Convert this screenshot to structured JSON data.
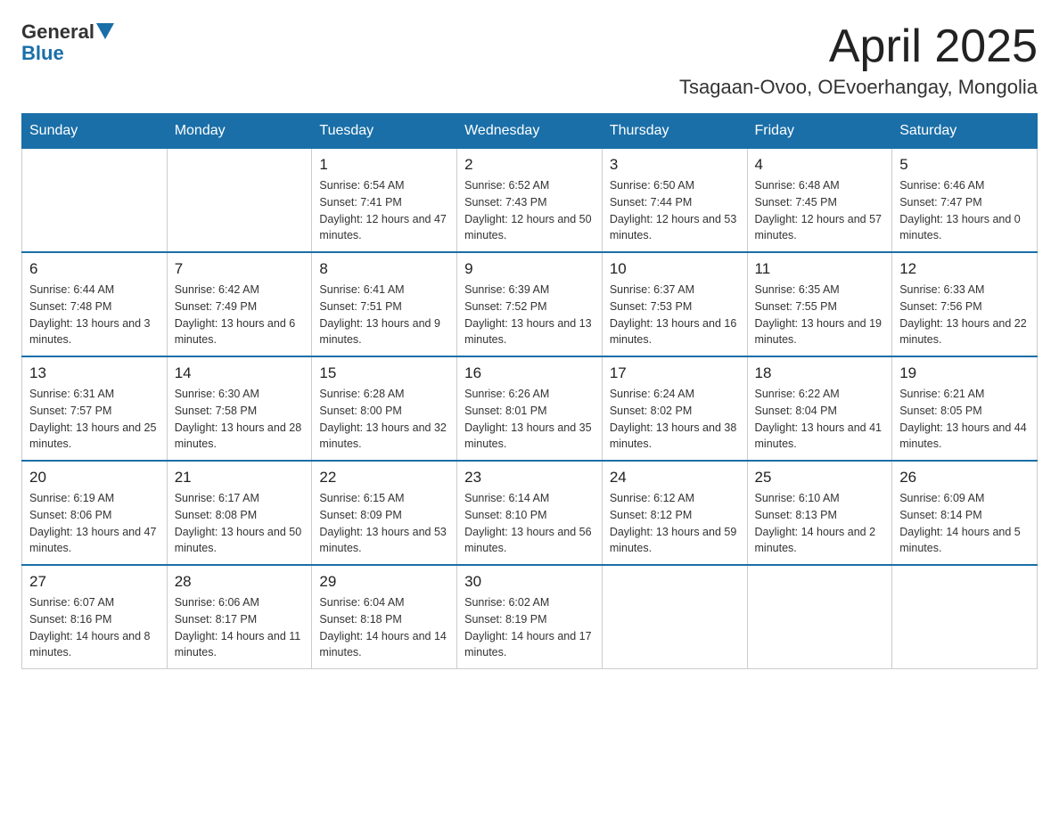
{
  "header": {
    "logo_general": "General",
    "logo_blue": "Blue",
    "month": "April 2025",
    "location": "Tsagaan-Ovoo, OEvoerhangay, Mongolia"
  },
  "weekdays": [
    "Sunday",
    "Monday",
    "Tuesday",
    "Wednesday",
    "Thursday",
    "Friday",
    "Saturday"
  ],
  "weeks": [
    [
      {
        "day": "",
        "sunrise": "",
        "sunset": "",
        "daylight": ""
      },
      {
        "day": "",
        "sunrise": "",
        "sunset": "",
        "daylight": ""
      },
      {
        "day": "1",
        "sunrise": "Sunrise: 6:54 AM",
        "sunset": "Sunset: 7:41 PM",
        "daylight": "Daylight: 12 hours and 47 minutes."
      },
      {
        "day": "2",
        "sunrise": "Sunrise: 6:52 AM",
        "sunset": "Sunset: 7:43 PM",
        "daylight": "Daylight: 12 hours and 50 minutes."
      },
      {
        "day": "3",
        "sunrise": "Sunrise: 6:50 AM",
        "sunset": "Sunset: 7:44 PM",
        "daylight": "Daylight: 12 hours and 53 minutes."
      },
      {
        "day": "4",
        "sunrise": "Sunrise: 6:48 AM",
        "sunset": "Sunset: 7:45 PM",
        "daylight": "Daylight: 12 hours and 57 minutes."
      },
      {
        "day": "5",
        "sunrise": "Sunrise: 6:46 AM",
        "sunset": "Sunset: 7:47 PM",
        "daylight": "Daylight: 13 hours and 0 minutes."
      }
    ],
    [
      {
        "day": "6",
        "sunrise": "Sunrise: 6:44 AM",
        "sunset": "Sunset: 7:48 PM",
        "daylight": "Daylight: 13 hours and 3 minutes."
      },
      {
        "day": "7",
        "sunrise": "Sunrise: 6:42 AM",
        "sunset": "Sunset: 7:49 PM",
        "daylight": "Daylight: 13 hours and 6 minutes."
      },
      {
        "day": "8",
        "sunrise": "Sunrise: 6:41 AM",
        "sunset": "Sunset: 7:51 PM",
        "daylight": "Daylight: 13 hours and 9 minutes."
      },
      {
        "day": "9",
        "sunrise": "Sunrise: 6:39 AM",
        "sunset": "Sunset: 7:52 PM",
        "daylight": "Daylight: 13 hours and 13 minutes."
      },
      {
        "day": "10",
        "sunrise": "Sunrise: 6:37 AM",
        "sunset": "Sunset: 7:53 PM",
        "daylight": "Daylight: 13 hours and 16 minutes."
      },
      {
        "day": "11",
        "sunrise": "Sunrise: 6:35 AM",
        "sunset": "Sunset: 7:55 PM",
        "daylight": "Daylight: 13 hours and 19 minutes."
      },
      {
        "day": "12",
        "sunrise": "Sunrise: 6:33 AM",
        "sunset": "Sunset: 7:56 PM",
        "daylight": "Daylight: 13 hours and 22 minutes."
      }
    ],
    [
      {
        "day": "13",
        "sunrise": "Sunrise: 6:31 AM",
        "sunset": "Sunset: 7:57 PM",
        "daylight": "Daylight: 13 hours and 25 minutes."
      },
      {
        "day": "14",
        "sunrise": "Sunrise: 6:30 AM",
        "sunset": "Sunset: 7:58 PM",
        "daylight": "Daylight: 13 hours and 28 minutes."
      },
      {
        "day": "15",
        "sunrise": "Sunrise: 6:28 AM",
        "sunset": "Sunset: 8:00 PM",
        "daylight": "Daylight: 13 hours and 32 minutes."
      },
      {
        "day": "16",
        "sunrise": "Sunrise: 6:26 AM",
        "sunset": "Sunset: 8:01 PM",
        "daylight": "Daylight: 13 hours and 35 minutes."
      },
      {
        "day": "17",
        "sunrise": "Sunrise: 6:24 AM",
        "sunset": "Sunset: 8:02 PM",
        "daylight": "Daylight: 13 hours and 38 minutes."
      },
      {
        "day": "18",
        "sunrise": "Sunrise: 6:22 AM",
        "sunset": "Sunset: 8:04 PM",
        "daylight": "Daylight: 13 hours and 41 minutes."
      },
      {
        "day": "19",
        "sunrise": "Sunrise: 6:21 AM",
        "sunset": "Sunset: 8:05 PM",
        "daylight": "Daylight: 13 hours and 44 minutes."
      }
    ],
    [
      {
        "day": "20",
        "sunrise": "Sunrise: 6:19 AM",
        "sunset": "Sunset: 8:06 PM",
        "daylight": "Daylight: 13 hours and 47 minutes."
      },
      {
        "day": "21",
        "sunrise": "Sunrise: 6:17 AM",
        "sunset": "Sunset: 8:08 PM",
        "daylight": "Daylight: 13 hours and 50 minutes."
      },
      {
        "day": "22",
        "sunrise": "Sunrise: 6:15 AM",
        "sunset": "Sunset: 8:09 PM",
        "daylight": "Daylight: 13 hours and 53 minutes."
      },
      {
        "day": "23",
        "sunrise": "Sunrise: 6:14 AM",
        "sunset": "Sunset: 8:10 PM",
        "daylight": "Daylight: 13 hours and 56 minutes."
      },
      {
        "day": "24",
        "sunrise": "Sunrise: 6:12 AM",
        "sunset": "Sunset: 8:12 PM",
        "daylight": "Daylight: 13 hours and 59 minutes."
      },
      {
        "day": "25",
        "sunrise": "Sunrise: 6:10 AM",
        "sunset": "Sunset: 8:13 PM",
        "daylight": "Daylight: 14 hours and 2 minutes."
      },
      {
        "day": "26",
        "sunrise": "Sunrise: 6:09 AM",
        "sunset": "Sunset: 8:14 PM",
        "daylight": "Daylight: 14 hours and 5 minutes."
      }
    ],
    [
      {
        "day": "27",
        "sunrise": "Sunrise: 6:07 AM",
        "sunset": "Sunset: 8:16 PM",
        "daylight": "Daylight: 14 hours and 8 minutes."
      },
      {
        "day": "28",
        "sunrise": "Sunrise: 6:06 AM",
        "sunset": "Sunset: 8:17 PM",
        "daylight": "Daylight: 14 hours and 11 minutes."
      },
      {
        "day": "29",
        "sunrise": "Sunrise: 6:04 AM",
        "sunset": "Sunset: 8:18 PM",
        "daylight": "Daylight: 14 hours and 14 minutes."
      },
      {
        "day": "30",
        "sunrise": "Sunrise: 6:02 AM",
        "sunset": "Sunset: 8:19 PM",
        "daylight": "Daylight: 14 hours and 17 minutes."
      },
      {
        "day": "",
        "sunrise": "",
        "sunset": "",
        "daylight": ""
      },
      {
        "day": "",
        "sunrise": "",
        "sunset": "",
        "daylight": ""
      },
      {
        "day": "",
        "sunrise": "",
        "sunset": "",
        "daylight": ""
      }
    ]
  ]
}
